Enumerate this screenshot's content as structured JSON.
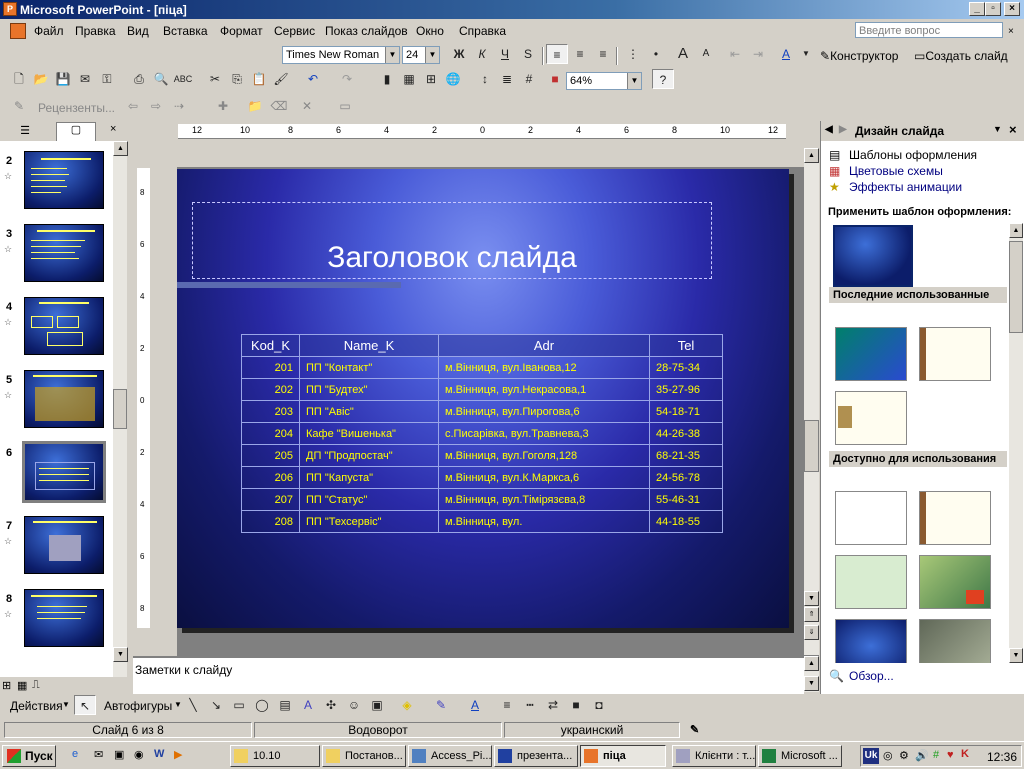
{
  "window": {
    "title": "Microsoft PowerPoint - [піца]"
  },
  "menu": {
    "items": [
      "Файл",
      "Правка",
      "Вид",
      "Вставка",
      "Формат",
      "Сервис",
      "Показ слайдов",
      "Окно",
      "Справка"
    ],
    "ask_placeholder": "Введите вопрос"
  },
  "format_toolbar": {
    "font": "Times New Roman",
    "size": "24",
    "designer_label": "Конструктор",
    "new_slide_label": "Создать слайд"
  },
  "standard_toolbar": {
    "zoom": "64%"
  },
  "review_toolbar": {
    "reviewers_label": "Рецензенты..."
  },
  "thumbnails": [
    {
      "num": "2"
    },
    {
      "num": "3"
    },
    {
      "num": "4"
    },
    {
      "num": "5"
    },
    {
      "num": "6"
    },
    {
      "num": "7"
    },
    {
      "num": "8"
    }
  ],
  "slide": {
    "title": "Заголовок слайда",
    "table": {
      "headers": [
        "Kod_K",
        "Name_K",
        "Adr",
        "Tel"
      ],
      "rows": [
        [
          "201",
          "ПП \"Контакт\"",
          "м.Вінниця, вул.Іванова,12",
          "28-75-34"
        ],
        [
          "202",
          "ПП \"Будтех\"",
          "м.Вінниця, вул.Некрасова,1",
          "35-27-96"
        ],
        [
          "203",
          "ПП \"Авіс\"",
          "м.Вінниця, вул.Пирогова,6",
          "54-18-71"
        ],
        [
          "204",
          "Кафе \"Вишенька\"",
          "с.Писарівка, вул.Травнева,3",
          "44-26-38"
        ],
        [
          "205",
          "ДП \"Продпостач\"",
          "м.Вінниця, вул.Гоголя,128",
          "68-21-35"
        ],
        [
          "206",
          "ПП \"Капуста\"",
          "м.Вінниця, вул.К.Маркса,6",
          "24-56-78"
        ],
        [
          "207",
          "ПП \"Статус\"",
          "м.Вінниця, вул.Тімірязєва,8",
          "55-46-31"
        ],
        [
          "208",
          "ПП \"Техсервіс\"",
          "м.Вінниця, вул.",
          "44-18-55"
        ]
      ]
    }
  },
  "notes": {
    "placeholder": "Заметки к слайду"
  },
  "task_pane": {
    "title": "Дизайн слайда",
    "links": [
      "Шаблоны оформления",
      "Цветовые схемы",
      "Эффекты анимации"
    ],
    "apply_label": "Применить шаблон оформления:",
    "recent_label": "Последние использованные",
    "available_label": "Доступно для использования",
    "browse_label": "Обзор..."
  },
  "draw_toolbar": {
    "actions_label": "Действия",
    "autoshapes_label": "Автофигуры"
  },
  "status": {
    "slide": "Слайд 6 из 8",
    "design": "Водоворот",
    "language": "украинский"
  },
  "taskbar": {
    "start": "Пуск",
    "buttons": [
      "10.10",
      "Постанов...",
      "Access_Pi...",
      "презента...",
      "піца",
      "Клієнти : т...",
      "Microsoft ..."
    ],
    "clock": "12:36",
    "tray_lang": "Uk"
  }
}
